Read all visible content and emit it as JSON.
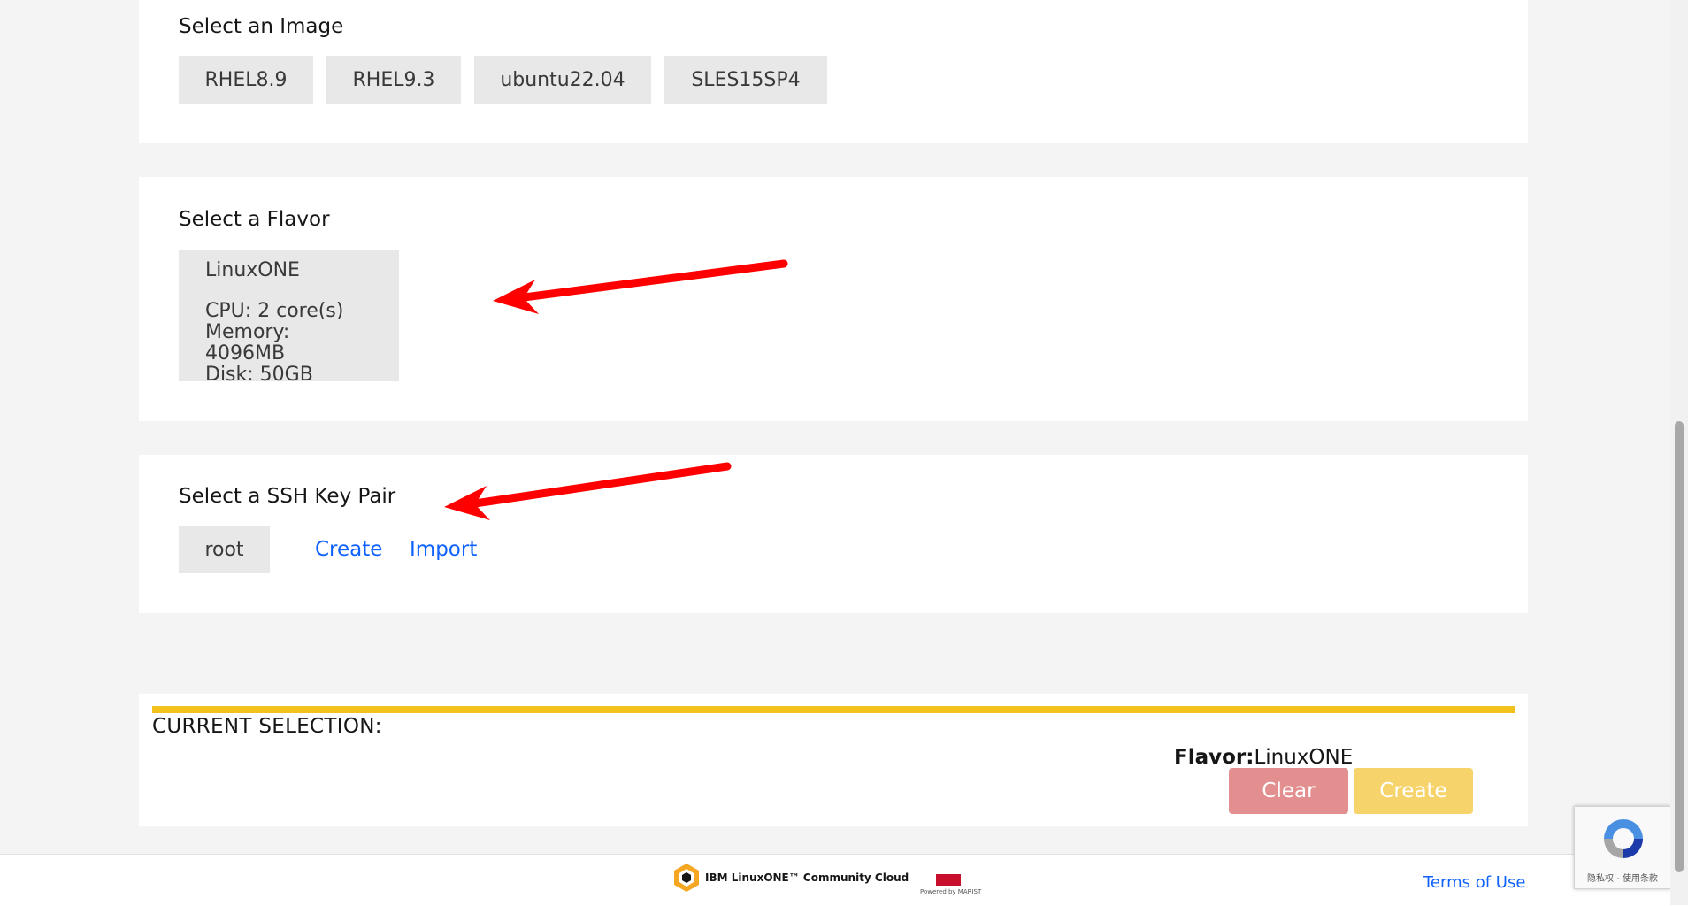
{
  "image_section": {
    "title": "Select an Image",
    "options": [
      "RHEL8.9",
      "RHEL9.3",
      "ubuntu22.04",
      "SLES15SP4"
    ]
  },
  "flavor_section": {
    "title": "Select a Flavor",
    "flavor": {
      "name": "LinuxONE",
      "cpu": "CPU: 2 core(s)",
      "memory": "Memory: 4096MB",
      "disk": "Disk: 50GB"
    }
  },
  "ssh_section": {
    "title": "Select a SSH Key Pair",
    "key": "root",
    "create_link": "Create",
    "import_link": "Import"
  },
  "current_selection": {
    "title": "CURRENT SELECTION:",
    "flavor_label": "Flavor:",
    "flavor_value": "LinuxONE",
    "clear_button": "Clear",
    "create_button": "Create"
  },
  "footer": {
    "logo_brand": "IBM LinuxONE™ Community Cloud",
    "powered_by": "Powered by MARIST",
    "terms_link": "Terms of Use"
  },
  "recaptcha": {
    "links": "隐私权 - 使用条款"
  },
  "colors": {
    "link": "#0f62fe",
    "selection_bar": "#f1c21b",
    "clear_button": "#e38f8f",
    "create_button": "#f6d46b",
    "annotation_arrow": "#ff0000"
  },
  "icons": [
    "linuxone-logo-icon",
    "marist-logo-icon",
    "recaptcha-icon",
    "annotation-arrow-icon"
  ]
}
